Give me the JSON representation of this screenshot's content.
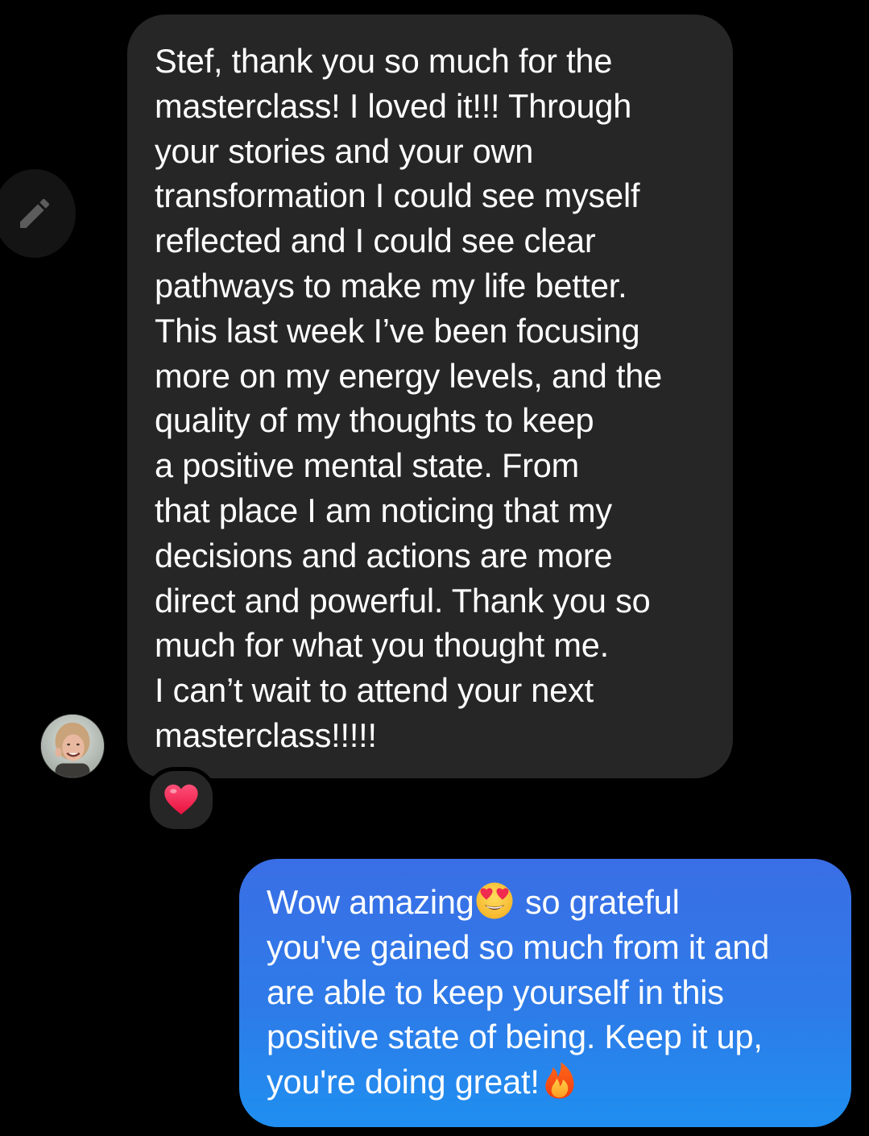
{
  "incoming_message": {
    "lines": [
      "Stef, thank you so much for the",
      "masterclass! I loved it!!! Through",
      "your stories and your own",
      "transformation I could see myself",
      "reflected and I could see clear",
      "pathways to make my life better.",
      "This last week I’ve been focusing",
      "more on my energy levels, and the",
      "quality of my thoughts to keep",
      "a positive mental state. From",
      "that place I am noticing that my",
      "decisions and actions are more",
      "direct and powerful. Thank you so",
      "much for what you thought me.",
      "I can’t wait to attend your next",
      "masterclass!!!!!"
    ],
    "reaction_icon": "red-heart-icon"
  },
  "outgoing_message": {
    "line1_before_emoji": "Wow amazing",
    "emoji_1": "heart-eyes-emoji-icon",
    "line1_after_emoji": " so grateful",
    "line2": "you've gained so much from it and",
    "line3": "are able to keep yourself in this",
    "line4": "positive state of being. Keep it up,",
    "line5": "you're doing great!",
    "emoji_2": "fire-emoji-icon"
  },
  "colors": {
    "background": "#000000",
    "incoming_bubble": "#262626",
    "outgoing_bubble_top": "#3a6ee6",
    "outgoing_bubble_bottom": "#1f8ff0",
    "text": "#ffffff"
  },
  "icons": {
    "edit": "pencil-icon",
    "avatar": "sender-avatar"
  }
}
